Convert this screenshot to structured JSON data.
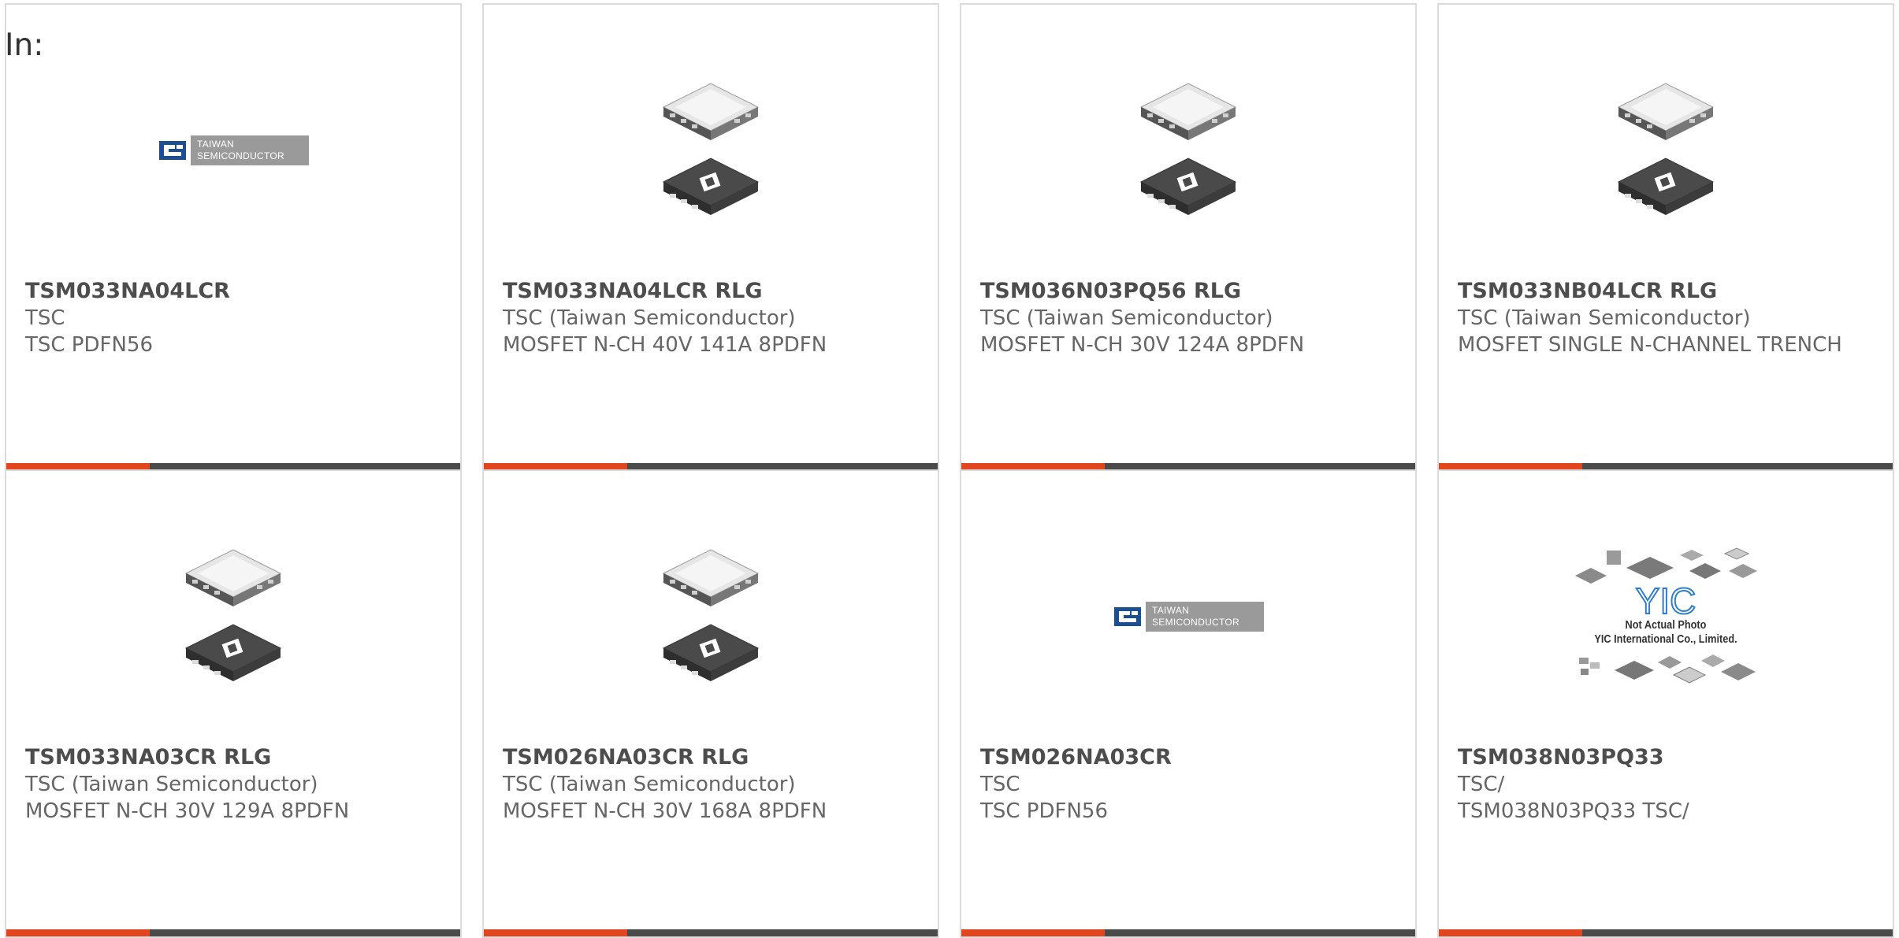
{
  "header": {
    "label": "In:"
  },
  "logo": {
    "line1": "TAIWAN",
    "line2": "SEMICONDUCTOR"
  },
  "yic": {
    "caption1": "Not Actual Photo",
    "caption2": "YIC International Co., Limited."
  },
  "colors": {
    "accent": "#e2461f",
    "bar": "#4a4a4a",
    "border": "#dcdcdc",
    "text": "#666666"
  },
  "products": [
    {
      "part": "TSM033NA04LCR",
      "manufacturer": "TSC",
      "description": "TSC PDFN56",
      "image": "tsc-logo"
    },
    {
      "part": "TSM033NA04LCR RLG",
      "manufacturer": "TSC (Taiwan Semiconductor)",
      "description": "MOSFET N-CH 40V 141A 8PDFN",
      "image": "pdfn-package"
    },
    {
      "part": "TSM036N03PQ56 RLG",
      "manufacturer": "TSC (Taiwan Semiconductor)",
      "description": "MOSFET N-CH 30V 124A 8PDFN",
      "image": "pdfn-package"
    },
    {
      "part": "TSM033NB04LCR RLG",
      "manufacturer": "TSC (Taiwan Semiconductor)",
      "description": "MOSFET SINGLE N-CHANNEL TRENCH",
      "image": "pdfn-package"
    },
    {
      "part": "TSM033NA03CR RLG",
      "manufacturer": "TSC (Taiwan Semiconductor)",
      "description": "MOSFET N-CH 30V 129A 8PDFN",
      "image": "pdfn-package"
    },
    {
      "part": "TSM026NA03CR RLG",
      "manufacturer": "TSC (Taiwan Semiconductor)",
      "description": "MOSFET N-CH 30V 168A 8PDFN",
      "image": "pdfn-package"
    },
    {
      "part": "TSM026NA03CR",
      "manufacturer": "TSC",
      "description": "TSC PDFN56",
      "image": "tsc-logo"
    },
    {
      "part": "TSM038N03PQ33",
      "manufacturer": "TSC/",
      "description": "TSM038N03PQ33 TSC/",
      "image": "yic-placeholder"
    }
  ]
}
